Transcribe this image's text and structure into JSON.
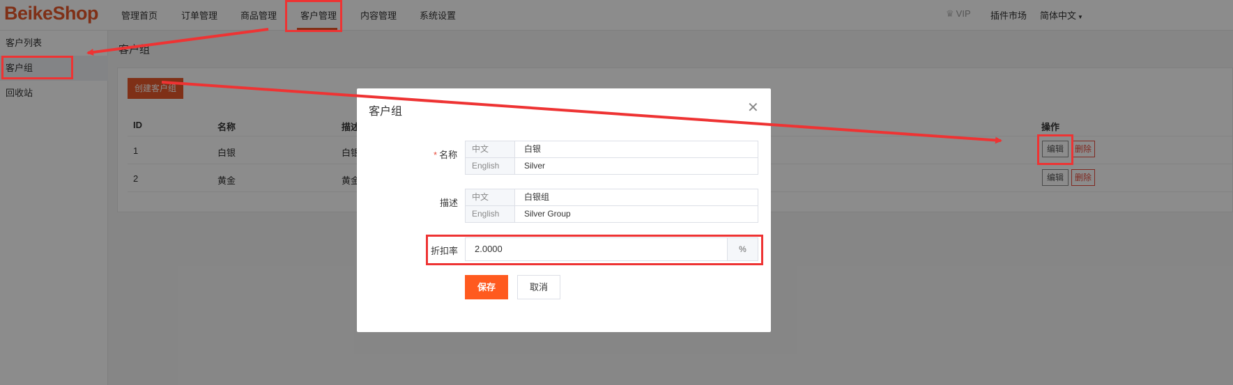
{
  "header": {
    "logo": "BeikeShop",
    "nav": [
      "管理首页",
      "订单管理",
      "商品管理",
      "客户管理",
      "内容管理",
      "系统设置"
    ],
    "active_nav": "客户管理",
    "vip": "VIP",
    "plugin_market": "插件市场",
    "language": "简体中文"
  },
  "sidebar": {
    "items": [
      "客户列表",
      "客户组",
      "回收站"
    ],
    "active": "客户组"
  },
  "main": {
    "page_title": "客户组",
    "create_button": "创建客户组",
    "columns": [
      "ID",
      "名称",
      "描述",
      "操作"
    ],
    "rows": [
      {
        "id": "1",
        "name": "白银",
        "desc": "白银"
      },
      {
        "id": "2",
        "name": "黄金",
        "desc": "黄金"
      }
    ],
    "edit_label": "编辑",
    "delete_label": "删除"
  },
  "modal": {
    "title": "客户组",
    "name_label": "名称",
    "desc_label": "描述",
    "discount_label": "折扣率",
    "lang_zh": "中文",
    "lang_en": "English",
    "name_zh": "白银",
    "name_en": "Silver",
    "desc_zh": "白银组",
    "desc_en": "Silver Group",
    "discount_value": "2.0000",
    "discount_suffix": "%",
    "save": "保存",
    "cancel": "取消"
  },
  "colors": {
    "brand": "#e8582a",
    "save_button": "#ff5a1f",
    "annotation": "#ee3333"
  }
}
